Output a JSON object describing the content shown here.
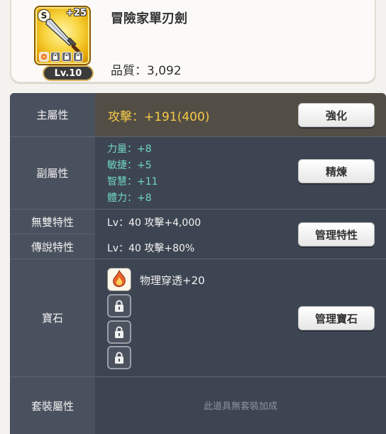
{
  "item": {
    "name": "冒險家單刃劍",
    "grade": "S",
    "enhance": "+25",
    "level": "Lv.10",
    "quality_label": "品質：",
    "quality_value": "3,092",
    "icon": "sword-icon"
  },
  "stats": {
    "main": {
      "label": "主屬性",
      "value": "攻擊：+191(400)",
      "button": "強化"
    },
    "sub": {
      "label": "副屬性",
      "items": [
        "力量：+8",
        "敏捷：+5",
        "智慧：+11",
        "體力：+8"
      ],
      "button": "精煉"
    },
    "unique_trait": {
      "label": "無雙特性",
      "value": "Lv：40 攻擊+4,000"
    },
    "legend_trait": {
      "label": "傳說特性",
      "value": "Lv：40 攻擊+80%"
    },
    "trait_button": "管理特性",
    "gem": {
      "label": "寶石",
      "slot1_text": "物理穿透+20",
      "button": "管理寶石"
    },
    "set": {
      "label": "套裝屬性",
      "value": "此道具無套裝加成"
    }
  },
  "colors": {
    "main_value": "#f7c948",
    "sub_value": "#6fd6c4",
    "panel_bg": "#3e4552"
  }
}
